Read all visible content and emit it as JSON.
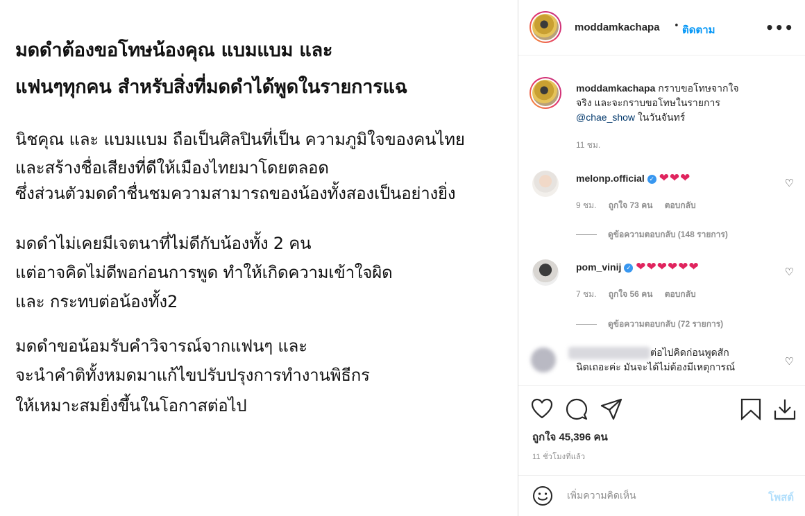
{
  "post_image": {
    "heading_lines": [
      "มดดำต้องขอโทษน้องคุณ แบมแบม และ",
      "แฟนๆทุกคน สำหรับสิ่งที่มดดำได้พูดในรายการแฉ"
    ],
    "paragraphs": [
      [
        "นิชคุณ และ แบมแบม ถือเป็นศิลปินที่เป็น ความภูมิใจของคนไทย",
        "และสร้างชื่อเสียงที่ดีให้เมืองไทยมาโดยตลอด",
        "ซึ่งส่วนตัวมดดำชื่นชมความสามารถของน้องทั้งสองเป็นอย่างยิ่ง"
      ],
      [
        "มดดำไม่เคยมีเจตนาที่ไม่ดีกับน้องทั้ง 2 คน",
        "แต่อาจคิดไม่ดีพอก่อนการพูด ทำให้เกิดความเข้าใจผิด",
        " และ กระทบต่อน้องทั้ง2"
      ],
      [
        "มดดำขอน้อมรับคำวิจารณ์จากแฟนๆ และ",
        "จะนำคำติทั้งหมดมาแก้ไขปรับปรุงการทำงานพิธีกร",
        "ให้เหมาะสมยิ่งขึ้นในโอกาสต่อไป"
      ]
    ]
  },
  "header": {
    "username": "moddamkachapa",
    "dot": "•",
    "follow_label": "ติดตาม",
    "more_label": "•••"
  },
  "caption": {
    "username": "moddamkachapa",
    "text_1": "กราบขอโทษจากใจ",
    "text_2": "จริง และจะกราบขอโทษในรายการ",
    "mention": "@chae_show",
    "text_3": " ในวันจันทร์",
    "time": "11 ชม."
  },
  "comments": [
    {
      "username": "melonp.official",
      "verified": true,
      "hearts": "❤❤❤",
      "time": "9 ชม.",
      "likes": "ถูกใจ 73 คน",
      "reply": "ตอบกลับ",
      "view_replies": "ดูข้อความตอบกลับ (148 รายการ)"
    },
    {
      "username": "pom_vinij",
      "verified": true,
      "hearts": "❤❤❤❤❤❤",
      "time": "7 ชม.",
      "likes": "ถูกใจ 56 คน",
      "reply": "ตอบกลับ",
      "view_replies": "ดูข้อความตอบกลับ (72 รายการ)"
    },
    {
      "text_1": "ต่อไปคิดก่อนพูดสัก",
      "text_2": "นิดเถอะค่ะ มันจะได้ไม่ต้องมีเหตุการณ์"
    }
  ],
  "actions": {
    "likes_label": "ถูกใจ 45,396 คน",
    "time_label": "11 ชั่วโมงที่แล้ว"
  },
  "add_comment": {
    "placeholder": "เพิ่มความคิดเห็น",
    "post_label": "โพสต์"
  },
  "colors": {
    "follow_blue": "#0095f6",
    "heart_red": "#e0245e",
    "verified_blue": "#3897f0",
    "muted_gray": "#8e8e8e"
  }
}
